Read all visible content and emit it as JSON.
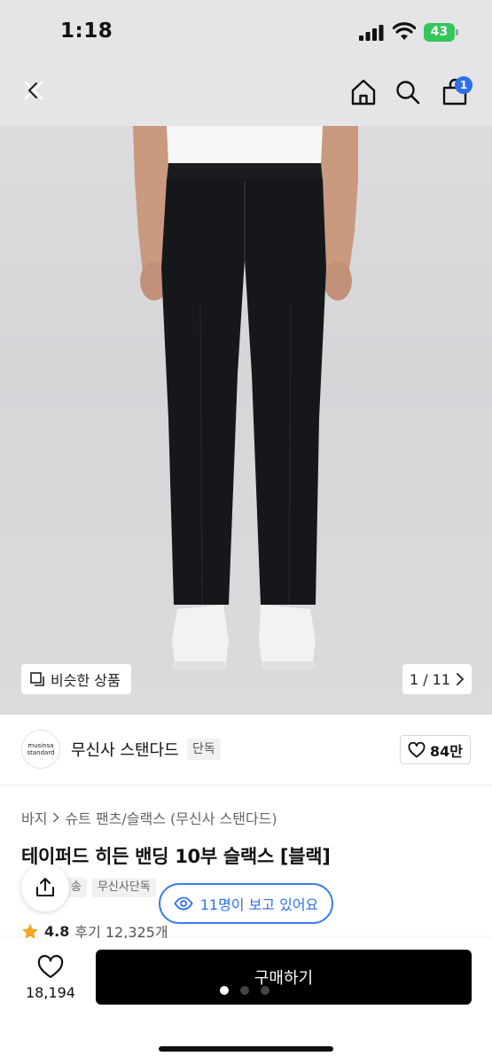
{
  "status_bar": {
    "time": "1:18",
    "battery": "43",
    "icons": [
      "signal-icon",
      "wifi-icon",
      "battery-icon"
    ]
  },
  "nav": {
    "icons": [
      "close-icon",
      "home-icon",
      "search-icon",
      "cart-icon"
    ],
    "cart_badge": "1"
  },
  "gallery": {
    "similar_label": "비슷한 상품",
    "page_indicator": "1 / 11",
    "icons": [
      "similar-items-icon",
      "chevron-right-icon"
    ]
  },
  "brand": {
    "logo_line1": "musinsa",
    "logo_line2": "standard",
    "name": "무신사 스탠다드",
    "tag": "단독",
    "likes": "84만"
  },
  "product": {
    "breadcrumb_1": "바지",
    "breadcrumb_2": "슈트 팬츠/슬랙스 (무신사 스탠다드)",
    "title": "테이퍼드 히든 밴딩 10부 슬랙스 [블랙]",
    "tags": [
      "송",
      "무신사단독"
    ],
    "viewers": "11명이 보고 있어요",
    "rating": "4.8",
    "reviews": "후기 12,325개"
  },
  "bottom": {
    "wish_count": "18,194",
    "buy_label": "구매하기",
    "colors": {
      "buy_bg": "#000000",
      "accent": "#2f6fea"
    }
  }
}
